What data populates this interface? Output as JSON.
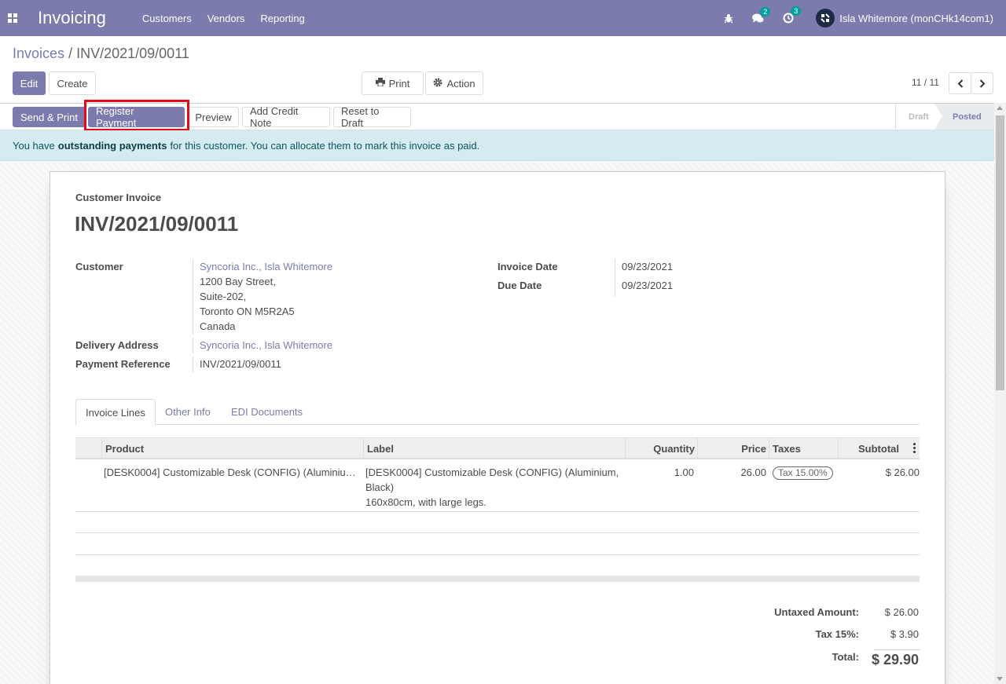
{
  "navbar": {
    "app_name": "Invoicing",
    "menu": [
      "Customers",
      "Vendors",
      "Reporting"
    ],
    "messages_count": "2",
    "activities_count": "3",
    "user": "Isla Whitemore (monCHk14com1)",
    "color": "#7c7bad"
  },
  "breadcrumb": {
    "parent": "Invoices",
    "separator": "/",
    "current": "INV/2021/09/0011"
  },
  "buttons": {
    "edit": "Edit",
    "create": "Create",
    "print": "Print",
    "action": "Action"
  },
  "pager": {
    "value": "11 / 11"
  },
  "statusbar": {
    "send_print": "Send & Print",
    "register_payment": "Register Payment",
    "preview": "Preview",
    "add_credit_note": "Add Credit Note",
    "reset_to_draft": "Reset to Draft",
    "stages": [
      "Draft",
      "Posted"
    ],
    "active_stage": "Posted"
  },
  "alert": {
    "prefix": "You have",
    "bold": "outstanding payments",
    "suffix": "for this customer. You can allocate them to mark this invoice as paid."
  },
  "invoice": {
    "type": "Customer Invoice",
    "name": "INV/2021/09/0011",
    "customer_label": "Customer",
    "customer": "Syncoria Inc., Isla Whitemore",
    "address": [
      "1200 Bay Street,",
      "Suite-202,",
      "Toronto ON M5R2A5",
      "Canada"
    ],
    "delivery_label": "Delivery Address",
    "delivery": "Syncoria Inc., Isla Whitemore",
    "payment_ref_label": "Payment Reference",
    "payment_ref": "INV/2021/09/0011",
    "invoice_date_label": "Invoice Date",
    "invoice_date": "09/23/2021",
    "due_date_label": "Due Date",
    "due_date": "09/23/2021"
  },
  "tabs": [
    "Invoice Lines",
    "Other Info",
    "EDI Documents"
  ],
  "table": {
    "columns": [
      "Product",
      "Label",
      "Quantity",
      "Price",
      "Taxes",
      "Subtotal"
    ],
    "rows": [
      {
        "product": "[DESK0004] Customizable Desk (CONFIG) (Aluminiu…",
        "label_lines": [
          "[DESK0004] Customizable Desk (CONFIG) (Aluminium,",
          "Black)",
          "160x80cm, with large legs."
        ],
        "quantity": "1.00",
        "price": "26.00",
        "tax": "Tax 15.00%",
        "subtotal": "$ 26.00"
      }
    ]
  },
  "totals": {
    "untaxed_label": "Untaxed Amount:",
    "untaxed": "$ 26.00",
    "tax_label": "Tax 15%:",
    "tax": "$ 3.90",
    "total_label": "Total:",
    "total": "$ 29.90"
  }
}
